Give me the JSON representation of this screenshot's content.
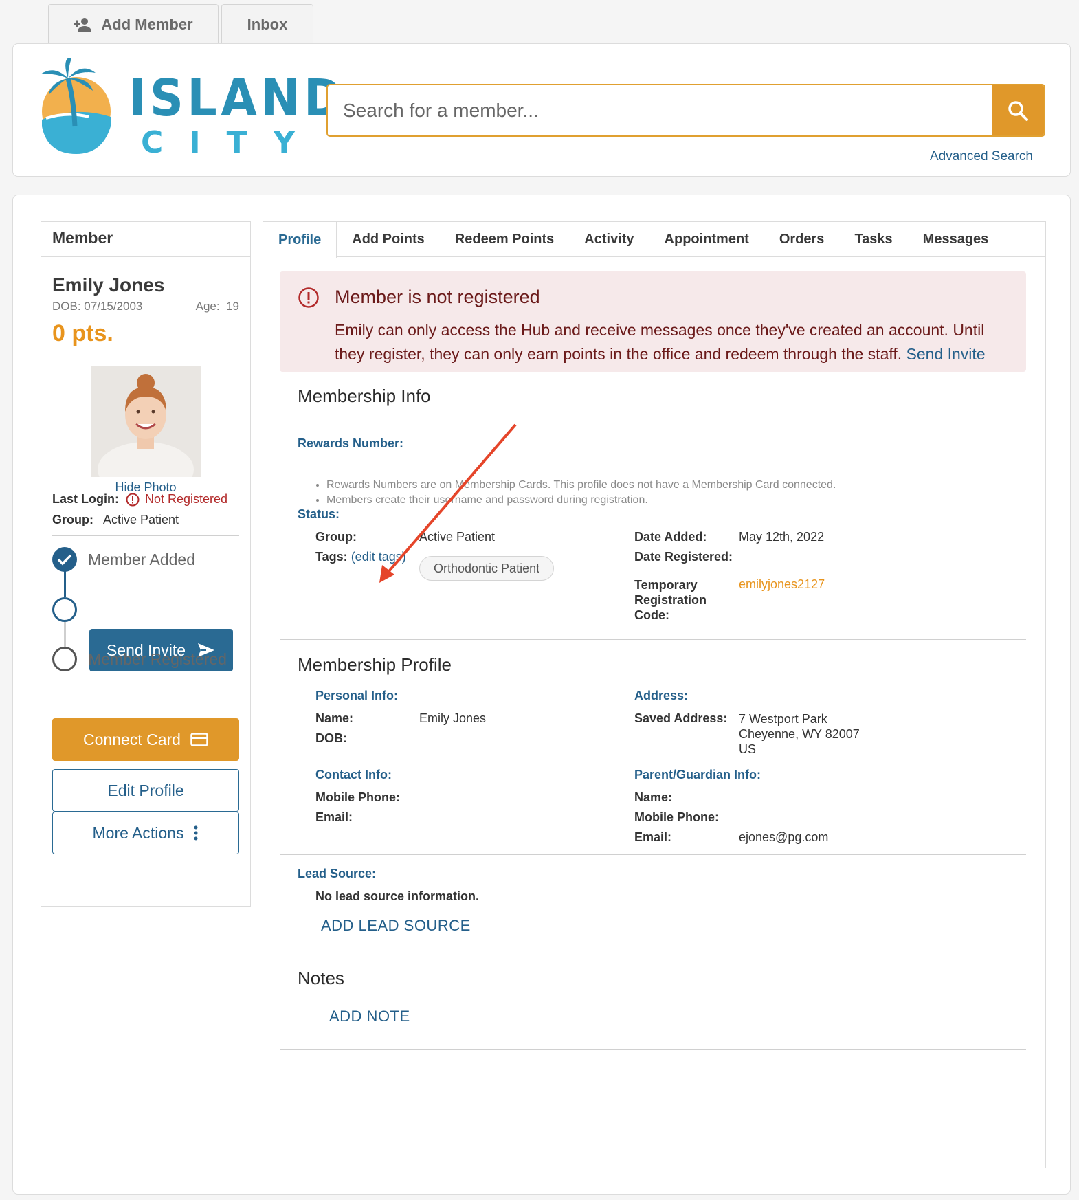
{
  "top_tabs": {
    "add_member": "Add Member",
    "inbox": "Inbox"
  },
  "brand": {
    "line1": "ISLAND",
    "line2": "CITY"
  },
  "search": {
    "placeholder": "Search for a member...",
    "advanced": "Advanced Search"
  },
  "sidebar": {
    "heading": "Member",
    "name": "Emily Jones",
    "dob": "DOB: 07/15/2003",
    "age_label": "Age:",
    "age": "19",
    "points": "0 pts.",
    "hide_photo": "Hide Photo",
    "last_login_label": "Last Login:",
    "last_login_value": "Not Registered",
    "group_label": "Group:",
    "group_value": "Active Patient",
    "steps": [
      "Member Added",
      "Member Registered"
    ],
    "send_invite": "Send Invite",
    "connect_card": "Connect Card",
    "edit_profile": "Edit Profile",
    "more_actions": "More Actions"
  },
  "tabs": [
    "Profile",
    "Add Points",
    "Redeem Points",
    "Activity",
    "Appointment",
    "Orders",
    "Tasks",
    "Messages"
  ],
  "alert": {
    "title": "Member is not registered",
    "body": "Emily can only access the Hub and receive messages once they've created an account. Until they register, they can only earn points in the office and redeem through the staff.",
    "link": "Send Invite"
  },
  "membership_info": {
    "title": "Membership Info",
    "rewards_label": "Rewards Number:",
    "rewards_notes": [
      "Rewards Numbers are on Membership Cards. This profile does not have a Membership Card connected.",
      "Members create their username and password during registration."
    ],
    "status_label": "Status:",
    "group_label": "Group:",
    "group_value": "Active Patient",
    "tags_label": "Tags:",
    "edit_tags": "(edit tags)",
    "tag": "Orthodontic Patient",
    "date_added_label": "Date Added:",
    "date_added_value": "May 12th, 2022",
    "date_registered_label": "Date Registered:",
    "temp_code_label": "Temporary Registration Code:",
    "temp_code_value": "emilyjones2127"
  },
  "membership_profile": {
    "title": "Membership Profile",
    "personal_label": "Personal Info:",
    "name_label": "Name:",
    "name_value": "Emily Jones",
    "dob_label": "DOB:",
    "contact_label": "Contact Info:",
    "mobile_label": "Mobile Phone:",
    "email_label": "Email:",
    "address_label": "Address:",
    "saved_address_label": "Saved Address:",
    "address_lines": [
      "7 Westport Park",
      "Cheyenne, WY 82007",
      "US"
    ],
    "guardian_label": "Parent/Guardian Info:",
    "g_name_label": "Name:",
    "g_mobile_label": "Mobile Phone:",
    "g_email_label": "Email:",
    "g_email_value": "ejones@pg.com"
  },
  "lead_source": {
    "label": "Lead Source:",
    "empty": "No lead source information.",
    "add": "ADD LEAD SOURCE"
  },
  "notes": {
    "title": "Notes",
    "add": "ADD NOTE"
  },
  "colors": {
    "primary": "#2a6a93",
    "accent": "#e0982a",
    "danger": "#b22a2a",
    "alert_bg": "#f6e9ea"
  }
}
